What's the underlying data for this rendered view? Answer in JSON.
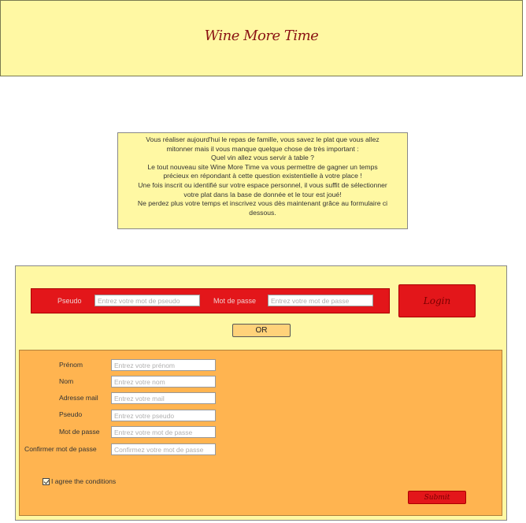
{
  "header": {
    "title": "Wine More Time"
  },
  "intro": {
    "lines": [
      "Vous réaliser aujourd'hui le repas de famille, vous savez le plat que vous allez",
      "mitonner mais il vous manque quelque chose de très important :",
      "Quel vin allez vous servir à table ?",
      "Le tout nouveau site Wine More Time va vous permettre de gagner un temps",
      "précieux en répondant à cette question existentielle à votre place !",
      "Une fois inscrit ou identifié sur votre espace personnel, il vous suffit de sélectionner",
      "votre plat dans la base de donnée et le tour est joué!",
      "Ne perdez plus votre temps et inscrivez vous dès maintenant grâce au formulaire ci",
      "dessous."
    ]
  },
  "login": {
    "pseudo_label": "Pseudo",
    "pseudo_placeholder": "Entrez votre mot de pseudo",
    "password_label": "Mot de passe",
    "password_placeholder": "Entrez votre mot de passe",
    "login_button": "Login"
  },
  "or_button": "OR",
  "signup": {
    "fields": [
      {
        "label": "Prénom",
        "placeholder": "Entrez votre prénom"
      },
      {
        "label": "Nom",
        "placeholder": "Entrez votre nom"
      },
      {
        "label": "Adresse mail",
        "placeholder": "Entrez votre mail"
      },
      {
        "label": "Pseudo",
        "placeholder": "Entrez votre pseudo"
      },
      {
        "label": "Mot de passe",
        "placeholder": "Entrez votre mot de passe"
      },
      {
        "label": "Confirmer mot de passe",
        "placeholder": "Confirmez votre mot de passe"
      }
    ],
    "agree_label": "I agree the conditions",
    "agree_checked": true,
    "submit_button": "Submit"
  },
  "colors": {
    "header_bg": "#fff8a3",
    "title": "#8b1414",
    "login_red": "#e3161a",
    "form_orange": "#ffb450",
    "or_button": "#ffd27a"
  }
}
